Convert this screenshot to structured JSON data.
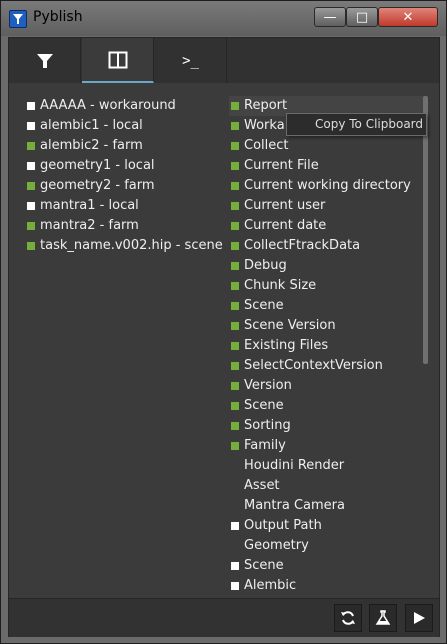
{
  "window": {
    "title": "Pyblish"
  },
  "titlebar_buttons": {
    "minimize": "—",
    "maximize": "□",
    "close": "✕"
  },
  "tabs": [
    {
      "name": "filter",
      "icon": "filter-icon"
    },
    {
      "name": "columns",
      "icon": "columns-icon",
      "selected": true
    },
    {
      "name": "terminal",
      "icon": "terminal-icon",
      "glyph": ">_"
    }
  ],
  "instances": [
    {
      "label": "AAAAA - workaround",
      "check": "white"
    },
    {
      "label": "alembic1 - local",
      "check": "white"
    },
    {
      "label": "alembic2 - farm",
      "check": "green"
    },
    {
      "label": "geometry1 - local",
      "check": "white"
    },
    {
      "label": "geometry2 - farm",
      "check": "green"
    },
    {
      "label": "mantra1 - local",
      "check": "white"
    },
    {
      "label": "mantra2 - farm",
      "check": "green"
    },
    {
      "label": "task_name.v002.hip - scene",
      "check": "green"
    }
  ],
  "plugins": [
    {
      "label": "Report",
      "check": "green"
    },
    {
      "label": "Worka",
      "check": "green"
    },
    {
      "label": "Collect",
      "check": "green"
    },
    {
      "label": "Current File",
      "check": "green"
    },
    {
      "label": "Current working directory",
      "check": "green"
    },
    {
      "label": "Current user",
      "check": "green"
    },
    {
      "label": "Current date",
      "check": "green"
    },
    {
      "label": "CollectFtrackData",
      "check": "green"
    },
    {
      "label": "Debug",
      "check": "green"
    },
    {
      "label": "Chunk Size",
      "check": "green"
    },
    {
      "label": "Scene",
      "check": "green"
    },
    {
      "label": "Scene Version",
      "check": "green"
    },
    {
      "label": "Existing Files",
      "check": "green"
    },
    {
      "label": "SelectContextVersion",
      "check": "green"
    },
    {
      "label": "Version",
      "check": "green"
    },
    {
      "label": "Scene",
      "check": "green"
    },
    {
      "label": "Sorting",
      "check": "green"
    },
    {
      "label": "Family",
      "check": "green"
    },
    {
      "label": "Houdini Render",
      "check": "none"
    },
    {
      "label": "Asset",
      "check": "none"
    },
    {
      "label": "Mantra Camera",
      "check": "none"
    },
    {
      "label": "Output Path",
      "check": "white"
    },
    {
      "label": "Geometry",
      "check": "none"
    },
    {
      "label": "Scene",
      "check": "white"
    },
    {
      "label": "Alembic",
      "check": "white"
    }
  ],
  "context_menu": {
    "item": "Copy To Clipboard"
  },
  "footer": {
    "buttons": [
      "refresh-icon",
      "validate-icon",
      "publish-icon"
    ]
  },
  "colors": {
    "green_check": "#77ad3b",
    "white_check": "#ffffff",
    "tab_accent": "#6aa8c8",
    "close_button": "#c0392b"
  }
}
